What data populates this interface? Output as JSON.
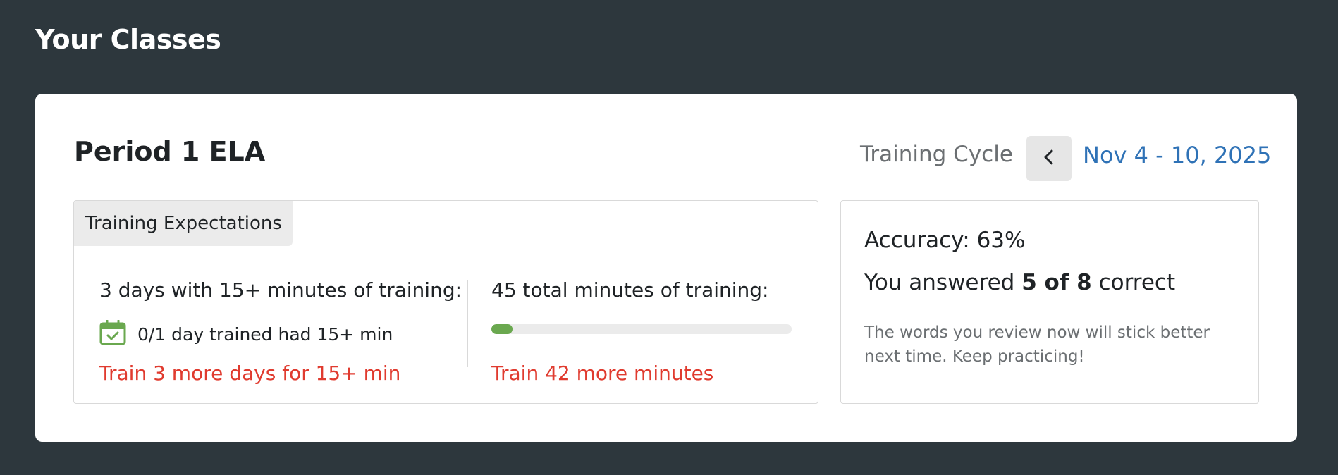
{
  "header": {
    "title": "Your Classes"
  },
  "class_card": {
    "name": "Period 1 ELA",
    "cycle": {
      "label": "Training Cycle",
      "date_range": "Nov 4 - 10, 2025",
      "prev_icon": "chevron-left-icon"
    },
    "expectations": {
      "tab_label": "Training Expectations",
      "days": {
        "heading": "3 days with 15+ minutes of training:",
        "icon": "calendar-check-icon",
        "status": "0/1 day trained had 15+ min",
        "warning": "Train 3 more days for 15+ min"
      },
      "minutes": {
        "heading": "45 total minutes of training:",
        "progress_fraction": 0.07,
        "warning": "Train 42 more minutes"
      }
    },
    "accuracy": {
      "title": "Accuracy: 63%",
      "answer_prefix": "You answered",
      "answer_count": "5 of 8",
      "answer_suffix": "correct",
      "note": "The words you review now will stick better next time. Keep practicing!"
    }
  },
  "colors": {
    "background": "#2d373d",
    "accent_blue": "#2f72b6",
    "warning_red": "#e03b2f",
    "progress_green": "#6aa84f"
  }
}
